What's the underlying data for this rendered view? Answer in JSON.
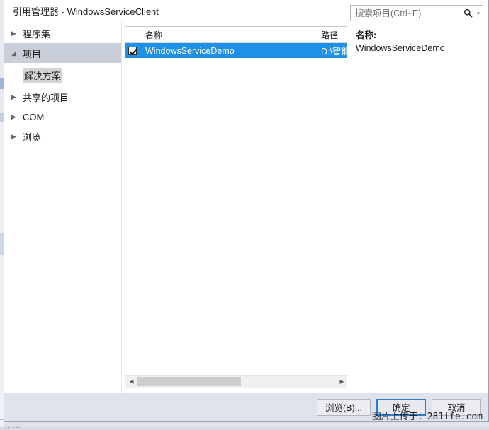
{
  "window": {
    "title_main": "引用管理器",
    "title_sep": " - ",
    "title_project": "WindowsServiceClient",
    "help_glyph": "?",
    "close_glyph": "✕"
  },
  "sidebar": {
    "items": [
      {
        "label": "程序集",
        "arrow": "▶",
        "expanded": false,
        "selected": false
      },
      {
        "label": "项目",
        "arrow": "◢",
        "expanded": true,
        "selected": true
      },
      {
        "label": "共享的项目",
        "arrow": "▶",
        "expanded": false,
        "selected": false
      },
      {
        "label": "COM",
        "arrow": "▶",
        "expanded": false,
        "selected": false
      },
      {
        "label": "浏览",
        "arrow": "▶",
        "expanded": false,
        "selected": false
      }
    ],
    "sub_item": "解决方案"
  },
  "search": {
    "placeholder": "搜索项目(Ctrl+E)",
    "value": "",
    "icon": "search-icon",
    "caret": "▾"
  },
  "list": {
    "columns": [
      "名称",
      "路径"
    ],
    "rows": [
      {
        "checked": true,
        "name": "WindowsServiceDemo",
        "path": "D:\\智能",
        "selected": true
      }
    ],
    "scrollbar": {
      "left_arrow": "◀",
      "right_arrow": "▶"
    }
  },
  "details": {
    "name_label": "名称:",
    "name_value": "WindowsServiceDemo"
  },
  "footer": {
    "browse_label": "浏览(B)...",
    "ok_label": "确定",
    "cancel_label": "取消"
  },
  "watermark": {
    "text": "图片上传于：281ife.com"
  },
  "backdrop": {
    "bottom_text": "……"
  },
  "colors": {
    "selection_blue": "#1e90e8",
    "nav_selected": "#c9cedb",
    "footer_bg": "#dfe3ec",
    "default_button_border": "#2a7fd4"
  }
}
